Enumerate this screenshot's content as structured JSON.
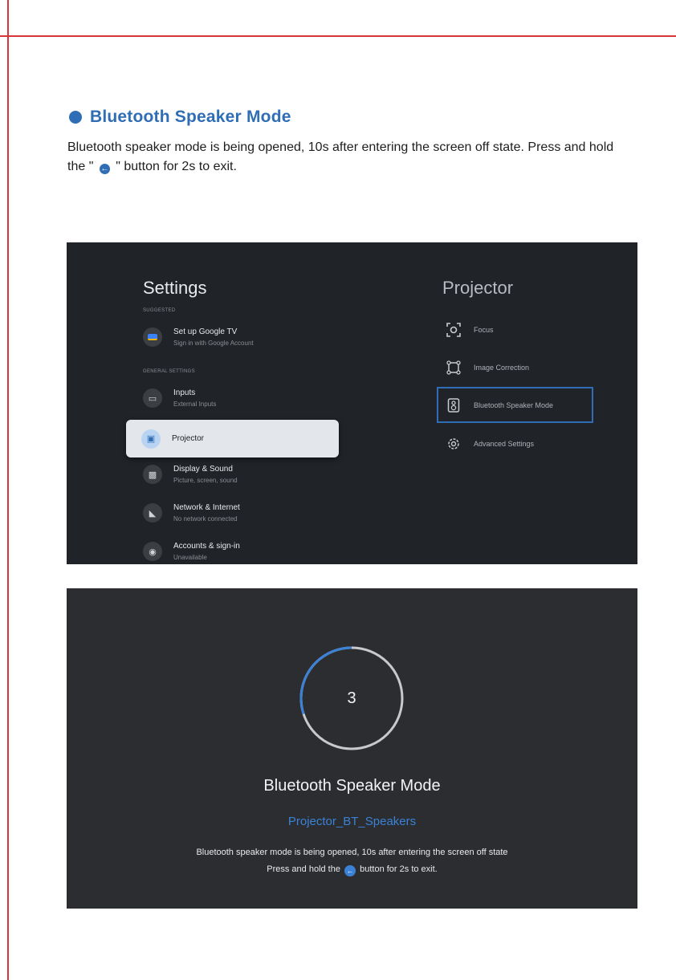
{
  "section": {
    "title": "Bluetooth Speaker Mode",
    "intro_part1": "Bluetooth speaker mode is being opened, 10s after entering the screen off state. Press and hold the \" ",
    "intro_part2": " \" button for 2s to exit."
  },
  "settings_screen": {
    "title": "Settings",
    "suggested_label": "SUGGESTED",
    "general_label": "GENERAL SETTINGS",
    "items": [
      {
        "title": "Set up Google TV",
        "desc": "Sign in with Google Account",
        "icon": "google-tv-icon"
      },
      {
        "title": "Inputs",
        "desc": "External Inputs",
        "icon": "tv-input-icon"
      },
      {
        "title": "Projector",
        "desc": "",
        "icon": "projector-icon"
      },
      {
        "title": "Display & Sound",
        "desc": "Picture, screen, sound",
        "icon": "display-icon"
      },
      {
        "title": "Network & Internet",
        "desc": "No network connected",
        "icon": "wifi-icon"
      },
      {
        "title": "Accounts & sign-in",
        "desc": "Unavailable",
        "icon": "account-icon"
      }
    ],
    "projector_title": "Projector",
    "projector_items": [
      {
        "label": "Focus",
        "icon": "focus-icon"
      },
      {
        "label": "Image Correction",
        "icon": "image-correction-icon"
      },
      {
        "label": "Bluetooth Speaker Mode",
        "icon": "speaker-icon"
      },
      {
        "label": "Advanced Settings",
        "icon": "gear-icon"
      }
    ]
  },
  "speaker_screen": {
    "countdown": "3",
    "countdown_progress": 0.3,
    "title": "Bluetooth Speaker Mode",
    "device_name": "Projector_BT_Speakers",
    "line1": "Bluetooth speaker mode is being opened, 10s after entering the screen off state",
    "line2_part1": "Press and hold the",
    "line2_part2": "button for 2s to exit."
  },
  "colors": {
    "accent": "#2f6db5",
    "rule": "#d9343a",
    "panel": "#202327"
  }
}
